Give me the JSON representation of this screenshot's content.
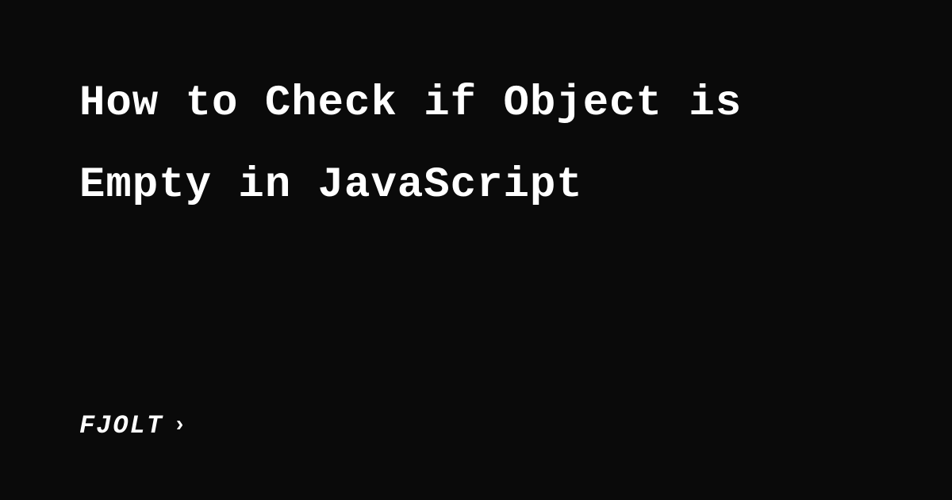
{
  "title": "How to Check if Object is Empty in JavaScript",
  "brand": {
    "name": "FJOLT",
    "chevron": "›"
  }
}
